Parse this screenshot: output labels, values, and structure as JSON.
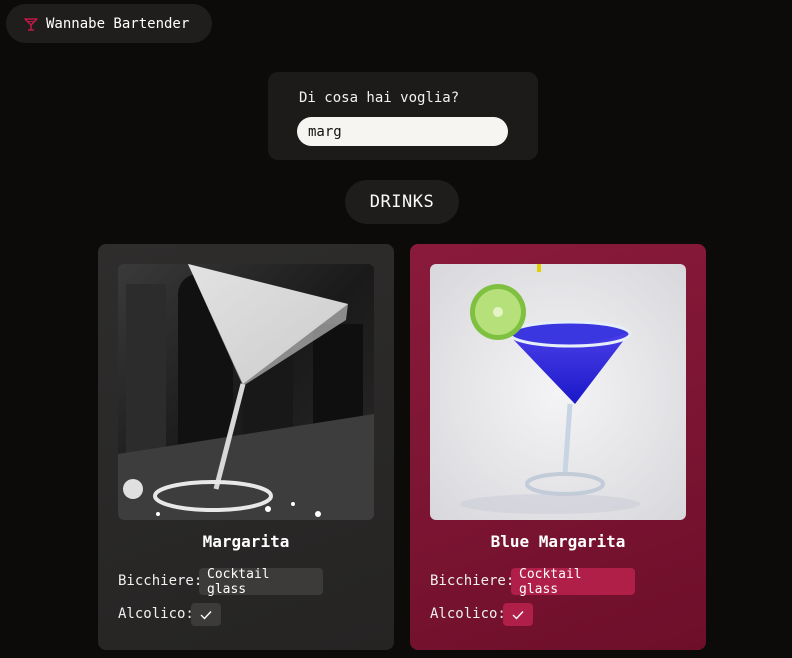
{
  "brand": {
    "name": "Wannabe Bartender",
    "icon": "martini-glass-icon",
    "accent": "#b3163c"
  },
  "search": {
    "label": "Di cosa hai voglia?",
    "value": "marg"
  },
  "section": {
    "title": "DRINKS"
  },
  "drinks": [
    {
      "name": "Margarita",
      "glass_label": "Bicchiere:",
      "glass": "Cocktail glass",
      "alcoholic_label": "Alcolico:",
      "alcoholic_icon": "check-icon",
      "card_color": "#2b2a29",
      "photo": "black-and-white photo of a margarita in a cocktail glass"
    },
    {
      "name": "Blue Margarita",
      "glass_label": "Bicchiere:",
      "glass": "Cocktail glass",
      "alcoholic_label": "Alcolico:",
      "alcoholic_icon": "check-icon",
      "card_color": "#7e1533",
      "photo": "blue margarita in a cocktail glass with lime wheel"
    }
  ]
}
